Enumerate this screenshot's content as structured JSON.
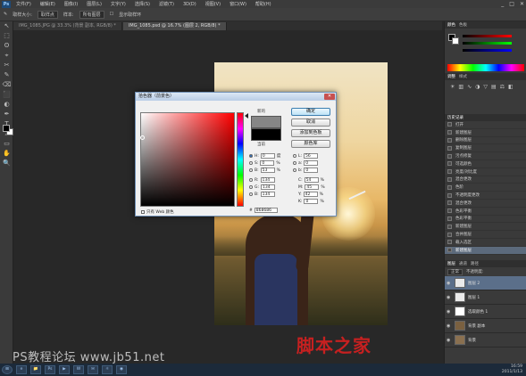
{
  "app": {
    "logo": "Ps",
    "menu": [
      "文件(F)",
      "编辑(E)",
      "图像(I)",
      "图层(L)",
      "文字(Y)",
      "选择(S)",
      "滤镜(T)",
      "3D(D)",
      "视图(V)",
      "窗口(W)",
      "帮助(H)"
    ],
    "window_controls": [
      "_",
      "□",
      "✕"
    ]
  },
  "options": {
    "brush_size_label": "取样大小:",
    "brush_size_value": "取样点",
    "sample_label": "样本:",
    "sample_value": "所有图层",
    "ring_label": "显示取样环"
  },
  "tabs": [
    {
      "label": "IMG_1085.JPG @ 33.3% (背景 副本, RGB/8) *"
    },
    {
      "label": "IMG_1085.psd @ 16.7% (图层 2, RGB/8) *"
    }
  ],
  "tools": [
    "↖",
    "⬚",
    "ʘ",
    "⌖",
    "✂",
    "✎",
    "⌫",
    "⬛",
    "◐",
    "✒",
    "T",
    "↗",
    "▭",
    "✋",
    "🔍"
  ],
  "dialog": {
    "title": "拾色器（前景色）",
    "close": "✕",
    "new_label": "新的",
    "current_label": "当前",
    "buttons": {
      "ok": "确定",
      "cancel": "取消",
      "add_swatch": "添加到色板",
      "color_libraries": "颜色库"
    },
    "hsb": [
      {
        "label": "H:",
        "value": "0",
        "unit": "度"
      },
      {
        "label": "S:",
        "value": "0",
        "unit": "%"
      },
      {
        "label": "B:",
        "value": "53",
        "unit": "%"
      }
    ],
    "rgb": [
      {
        "label": "R:",
        "value": "134"
      },
      {
        "label": "G:",
        "value": "134"
      },
      {
        "label": "B:",
        "value": "134"
      }
    ],
    "lab": [
      {
        "label": "L:",
        "value": "56"
      },
      {
        "label": "a:",
        "value": "0"
      },
      {
        "label": "b:",
        "value": "0"
      }
    ],
    "cmyk": [
      {
        "label": "C:",
        "value": "54",
        "unit": "%"
      },
      {
        "label": "M:",
        "value": "45",
        "unit": "%"
      },
      {
        "label": "Y:",
        "value": "42",
        "unit": "%"
      },
      {
        "label": "K:",
        "value": "0",
        "unit": "%"
      }
    ],
    "hex_label": "#",
    "hex_value": "868686",
    "web_only": "只有 Web 颜色",
    "colors": {
      "new": "#868686",
      "current": "#000000"
    }
  },
  "panels": {
    "color_tabs": [
      "颜色",
      "色板"
    ],
    "adj_tabs": [
      "调整",
      "样式"
    ],
    "history_tabs": [
      "历史记录"
    ],
    "history": [
      "打开",
      "新建图层",
      "删除图层",
      "复制图层",
      "污点修复",
      "可选颜色",
      "亮度/对比度",
      "混合更改",
      "色阶",
      "不透明度更改",
      "混合更改",
      "色彩平衡",
      "色彩平衡",
      "新建图层",
      "合并图层",
      "载入选区",
      "新建图层"
    ],
    "layers_tabs": [
      "图层",
      "通道",
      "路径"
    ],
    "blend_mode": "正常",
    "opacity_label": "不透明度:",
    "layers": [
      {
        "name": "图层 2",
        "selected": true
      },
      {
        "name": "图层 1",
        "selected": false
      },
      {
        "name": "选取颜色 1",
        "selected": false
      },
      {
        "name": "背景 副本",
        "selected": false
      },
      {
        "name": "背景",
        "selected": false
      }
    ]
  },
  "taskbar": {
    "start": "⊞",
    "items": [
      "e",
      "📁",
      "Ps",
      "▶",
      "W",
      "✉",
      "☼",
      "◉"
    ],
    "time": "16:59",
    "date": "2011/1/13"
  },
  "watermarks": {
    "cn": "脚本之家",
    "url": "PS教程论坛 www.jb51.net"
  }
}
